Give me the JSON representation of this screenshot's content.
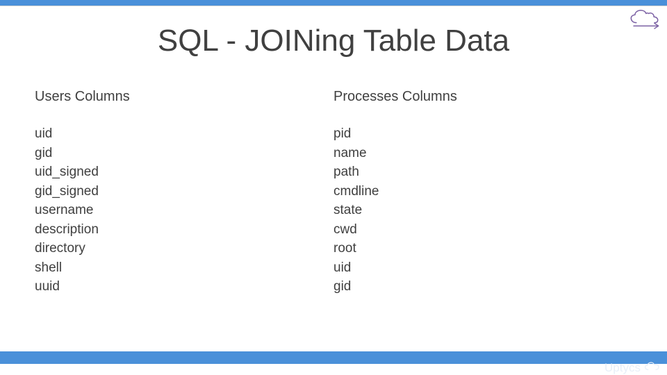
{
  "title": "SQL - JOINing Table Data",
  "left": {
    "header": "Users Columns",
    "items": [
      "uid",
      "gid",
      "uid_signed",
      "gid_signed",
      "username",
      "description",
      "directory",
      "shell",
      "uuid"
    ]
  },
  "right": {
    "header": "Processes Columns",
    "items": [
      "pid",
      "name",
      "path",
      "cmdline",
      "state",
      "cwd",
      "root",
      "uid",
      "gid"
    ]
  },
  "brand": "Uptycs",
  "colors": {
    "bar": "#4a90d9"
  }
}
